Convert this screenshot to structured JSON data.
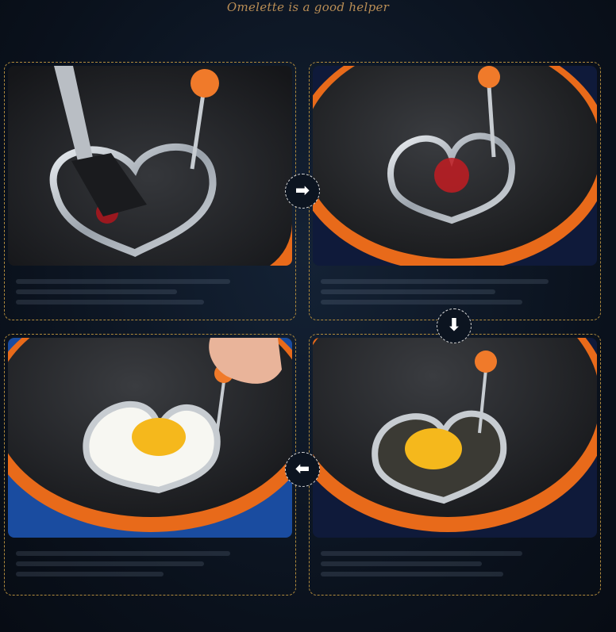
{
  "title": "Omelette is a good helper",
  "steps": [
    {
      "name": "brush-oil"
    },
    {
      "name": "place-ring"
    },
    {
      "name": "pour-egg"
    },
    {
      "name": "cook-egg"
    }
  ],
  "arrows": [
    {
      "direction": "right",
      "glyph": "➡"
    },
    {
      "direction": "down",
      "glyph": "⬇"
    },
    {
      "direction": "left",
      "glyph": "⬅"
    }
  ],
  "colors": {
    "title": "#b98d55",
    "border": "#b08a3c",
    "pan": "#1c1d20",
    "pan_rim": "#e86a1a",
    "knob": "#f07a2a",
    "yolk": "#f5b81c"
  }
}
